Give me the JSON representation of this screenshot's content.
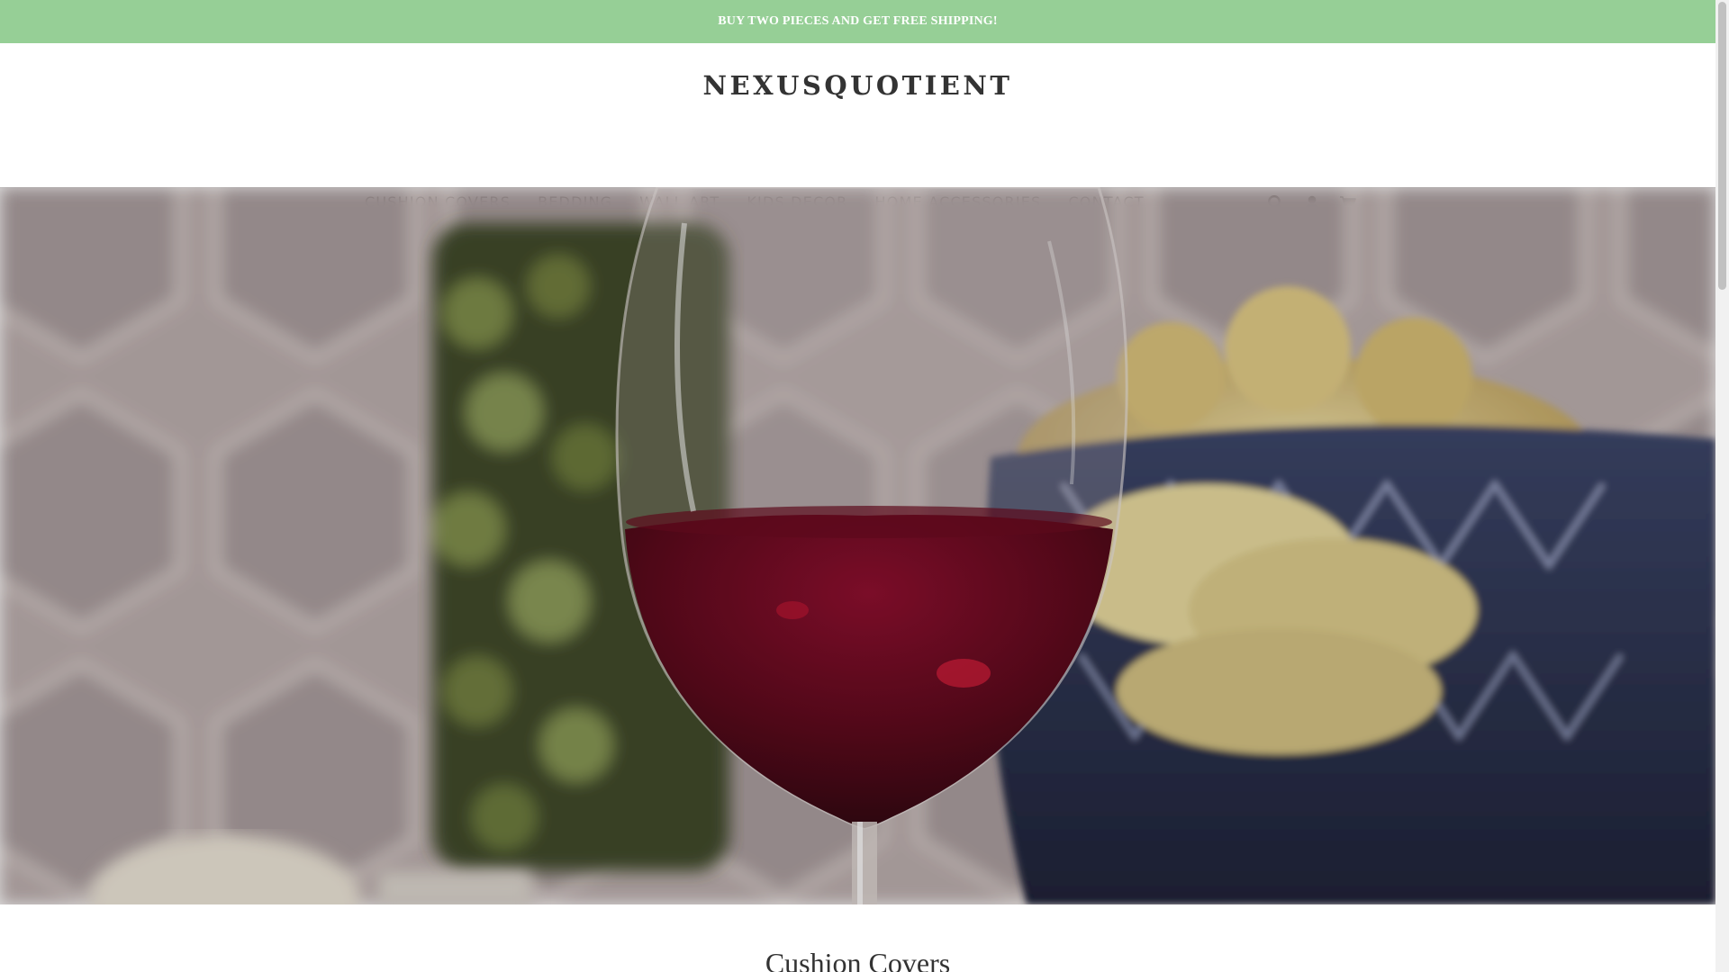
{
  "announcement": {
    "text": "BUY TWO PIECES AND GET FREE SHIPPING!"
  },
  "header": {
    "logo": "NEXUSQUOTIENT",
    "nav": [
      {
        "label": "CUSHION COVERS"
      },
      {
        "label": "BEDDING"
      },
      {
        "label": "WALL ART"
      },
      {
        "label": "KIDS DECOR"
      },
      {
        "label": "HOME ACCESSORIES"
      },
      {
        "label": "CONTACT"
      }
    ],
    "icons": [
      "search-icon",
      "account-icon",
      "cart-icon"
    ]
  },
  "collection": {
    "title": "Cushion Covers"
  },
  "colors": {
    "announcement_bg": "#96cf96",
    "text": "#333333"
  }
}
